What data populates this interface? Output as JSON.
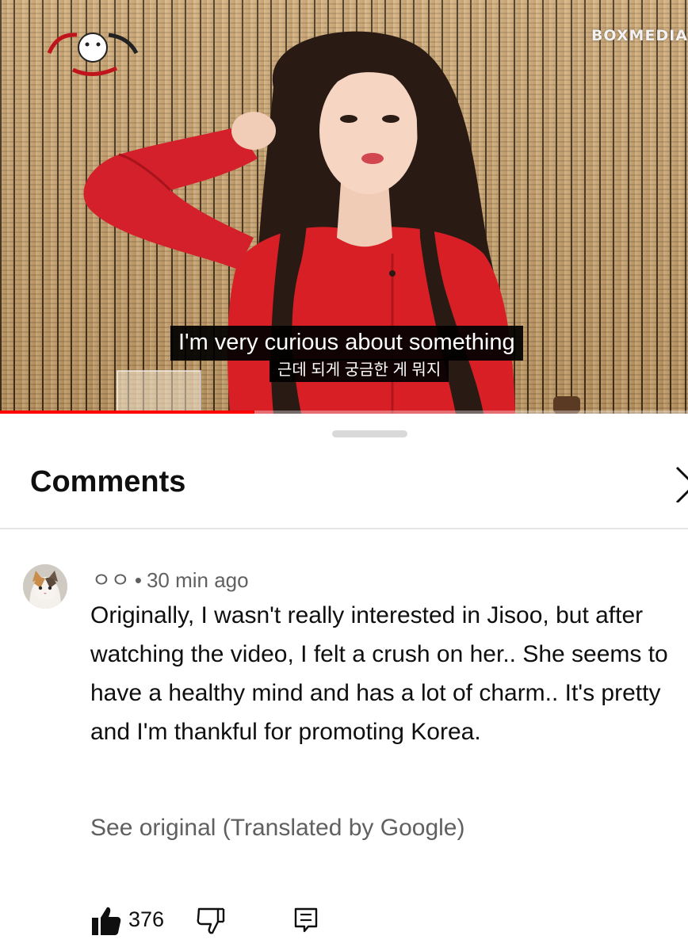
{
  "video": {
    "channel_logo": "BOXMEDIA",
    "subtitle_en": "I'm very curious about something",
    "subtitle_ko": "근데 되게 궁금한 게 뭐지",
    "progress_fraction": 0.37
  },
  "comments_panel": {
    "title": "Comments",
    "comment": {
      "author": "ㅇㅇ",
      "separator": "•",
      "time": "30 min ago",
      "text": "Originally, I wasn't really interested in Jisoo, but after watching the video, I felt a crush on her.. She seems to have a healthy mind and has a lot of charm.. It's pretty and I'm thankful for promoting Korea.",
      "translation_link": "See original (Translated by Google)",
      "like_count": "376"
    }
  },
  "icons": {
    "close": "close-icon",
    "like": "thumbs-up-icon",
    "dislike": "thumbs-down-icon",
    "reply": "reply-icon"
  },
  "colors": {
    "progress": "#ff0000",
    "text_primary": "#0f0f0f",
    "text_secondary": "#606060"
  }
}
